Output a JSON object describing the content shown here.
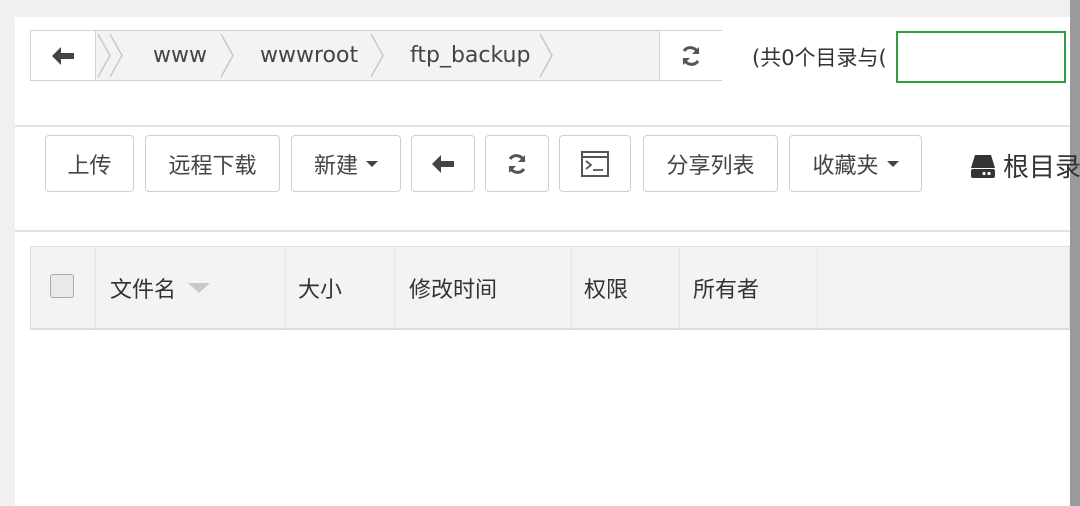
{
  "path": {
    "back_icon": "arrow-left-icon",
    "crumbs": [
      "www",
      "wwwroot",
      "ftp_backup"
    ],
    "refresh_icon": "refresh-icon"
  },
  "count_text": "(共0个目录与(",
  "search": {
    "value": "",
    "placeholder": ""
  },
  "toolbar": {
    "upload_label": "上传",
    "remote_download_label": "远程下载",
    "new_label": "新建",
    "back_icon": "arrow-left-icon",
    "refresh_icon": "refresh-icon",
    "terminal_icon": "terminal-icon",
    "share_list_label": "分享列表",
    "favorites_label": "收藏夹",
    "root_dir_label": "根目录",
    "disk_icon": "hard-drive-icon"
  },
  "table": {
    "columns": [
      "文件名",
      "大小",
      "修改时间",
      "权限",
      "所有者"
    ],
    "rows": []
  },
  "colors": {
    "search_border": "#2e9e3e",
    "background": "#f0f0f0"
  }
}
